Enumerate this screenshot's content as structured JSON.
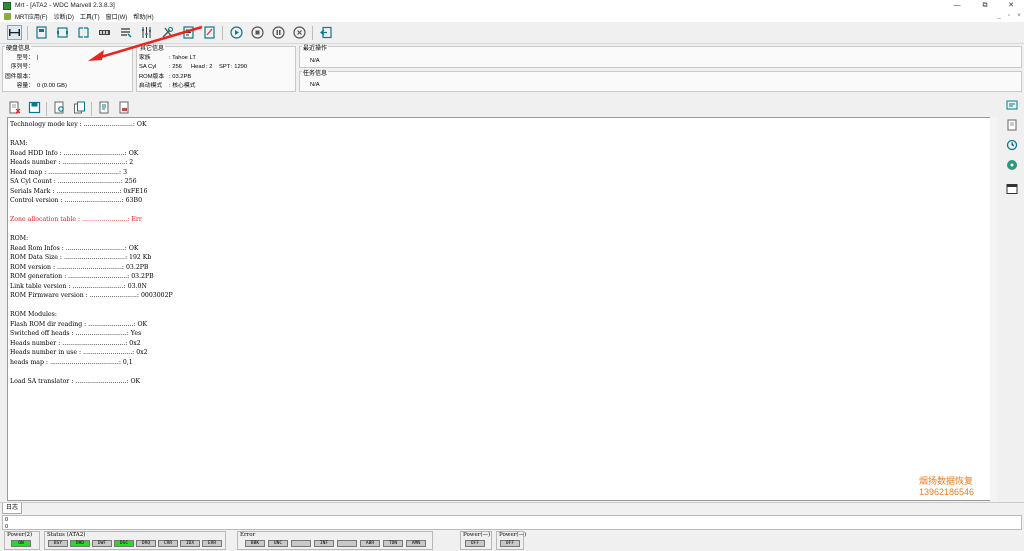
{
  "window": {
    "title": "Mrt - [ATA2 - WDC Marvell 2.3.8.3]",
    "min": "—",
    "max": "⧉",
    "close": "✕"
  },
  "menu": {
    "items": [
      "MRT应用(F)",
      "诊断(D)",
      "工具(T)",
      "窗口(W)",
      "帮助(H)"
    ],
    "right": [
      "_",
      "▫",
      "×"
    ]
  },
  "drive_info": {
    "header": "硬盘信息",
    "model_label": "型号：",
    "model": "|",
    "serial_label": "序列号：",
    "serial": "",
    "fw_label": "固件版本：",
    "fw": "",
    "capacity_label": "容量：",
    "capacity": "0 (0.00 GB)"
  },
  "other_info": {
    "header": "其它信息",
    "family_label": "家族",
    "family": ": Tahoe LT",
    "sacyl_label": "SA Cyl",
    "sacyl": ": 256",
    "head_label": "Head",
    "head": ": 2",
    "spt_label": "SPT",
    "spt": ": 1290",
    "rom_label": "ROM版本",
    "rom": ": 03.2PB",
    "boot_label": "启动模式",
    "boot": ": 核心模式"
  },
  "recent": {
    "header": "最近操作",
    "value": "N/A"
  },
  "task": {
    "header": "任务信息",
    "value": "N/A"
  },
  "log": {
    "lines": [
      {
        "t": "Technology mode key : .........................: OK",
        "err": false
      },
      {
        "t": "",
        "err": false
      },
      {
        "t": "RAM:",
        "err": false
      },
      {
        "t": "Read HDD Info : ...............................: OK",
        "err": false
      },
      {
        "t": "Heads number : ................................: 2",
        "err": false
      },
      {
        "t": "Head map : ....................................: 3",
        "err": false
      },
      {
        "t": "SA Cyl Count : ................................: 256",
        "err": false
      },
      {
        "t": "Serials Mark : ................................: 0xFE16",
        "err": false
      },
      {
        "t": "Control version : .............................: 63B0",
        "err": false
      },
      {
        "t": "",
        "err": false
      },
      {
        "t": "Zone allocation table : .......................: Err",
        "err": true
      },
      {
        "t": "",
        "err": false
      },
      {
        "t": "ROM:",
        "err": false
      },
      {
        "t": "Read Rom Infos : ..............................: OK",
        "err": false
      },
      {
        "t": "ROM Data Size : ...............................: 192 Kb",
        "err": false
      },
      {
        "t": "ROM version : .................................: 03.2PB",
        "err": false
      },
      {
        "t": "ROM generation : ..............................: 03.2PB",
        "err": false
      },
      {
        "t": "Link table version : ..........................: 03.0N",
        "err": false
      },
      {
        "t": "ROM Firmware version : ........................: 0003002P",
        "err": false
      },
      {
        "t": "",
        "err": false
      },
      {
        "t": "ROM Modules:",
        "err": false
      },
      {
        "t": "Flash ROM dir reading : .......................: OK",
        "err": false
      },
      {
        "t": "Switched off heads : ..........................: Yes",
        "err": false
      },
      {
        "t": "Heads number : ................................: 0x2",
        "err": false
      },
      {
        "t": "Heads number in use : .........................: 0x2",
        "err": false
      },
      {
        "t": "heads map : ...................................: 0,1",
        "err": false
      },
      {
        "t": "",
        "err": false
      },
      {
        "t": "Load SA translator : ..........................: OK",
        "err": false
      }
    ]
  },
  "watermark": {
    "line1": "烟扬数据恢复",
    "line2": "13962186546"
  },
  "tab": {
    "label": "日志"
  },
  "mini": {
    "l1": "0",
    "l2": "0"
  },
  "status": {
    "power_label": "Power(2)",
    "power_led": "ON",
    "ata_label": "Status (ATA2)",
    "ata_leds": [
      "BSY",
      "DRD",
      "DWF",
      "DSC",
      "DRQ",
      "CRR",
      "IDX",
      "ERR"
    ],
    "err_label": "Error",
    "err_leds": [
      "BBK",
      "UNC",
      "",
      "INF",
      "",
      "ABR",
      "TON",
      "AMN"
    ],
    "p1_label": "Power(—)",
    "p1_led": "OFF",
    "p2_label": "Power(—)",
    "p2_led": "OFF"
  }
}
